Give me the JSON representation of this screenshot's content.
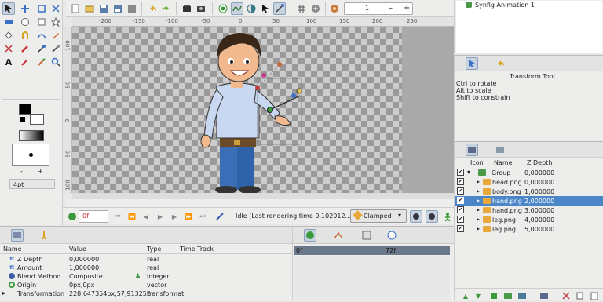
{
  "rulers": {
    "top": [
      "-200",
      "-150",
      "-100",
      "-50",
      "0",
      "50",
      "100",
      "150",
      "200",
      "250"
    ],
    "left": [
      "100",
      "50",
      "0",
      "50",
      "100",
      "150"
    ]
  },
  "toolbar": {
    "frame_value": "1",
    "minus": "–",
    "plus": "+"
  },
  "toolbox": {
    "width_value": "4pt",
    "minus": "-",
    "plus": "+"
  },
  "timebar": {
    "current_time": "0f",
    "status": "Idle (Last rendering time 0.102012...",
    "interpolation": "Clamped"
  },
  "canvas_browser": {
    "item": "Synfig Animation 1"
  },
  "tool_options": {
    "title": "Transform Tool",
    "hints": [
      "Ctrl to rotate",
      "Alt to scale",
      "Shift to constrain"
    ]
  },
  "layers": {
    "headers": [
      "Icon",
      "Name",
      "Z Depth"
    ],
    "rows": [
      {
        "name": "Group",
        "z": "0,000000",
        "type": "group"
      },
      {
        "name": "head.png",
        "z": "0,000000",
        "type": "image"
      },
      {
        "name": "body.png",
        "z": "1,000000",
        "type": "image"
      },
      {
        "name": "hand.png",
        "z": "2,000000",
        "type": "image",
        "selected": true
      },
      {
        "name": "hand.png",
        "z": "3,000000",
        "type": "image"
      },
      {
        "name": "leg.png",
        "z": "4,000000",
        "type": "image"
      },
      {
        "name": "leg.png",
        "z": "5,000000",
        "type": "image"
      }
    ]
  },
  "params": {
    "headers": [
      "Name",
      "Value",
      "Type",
      "Time Track"
    ],
    "rows": [
      {
        "name": "Z Depth",
        "value": "0,000000",
        "type": "real"
      },
      {
        "name": "Amount",
        "value": "1,000000",
        "type": "real"
      },
      {
        "name": "Blend Method",
        "value": "Composite",
        "type": "integer"
      },
      {
        "name": "Origin",
        "value": "0px,0px",
        "type": "vector"
      },
      {
        "name": "Transformation",
        "value": "228,647354px,57,913252",
        "type": "transformat"
      }
    ]
  },
  "timetrack": {
    "labels": [
      "0f",
      "72f"
    ]
  },
  "colors": {
    "selection": "#4a86c8",
    "checker_light": "#cccccc",
    "checker_dark": "#9a9a9a"
  }
}
